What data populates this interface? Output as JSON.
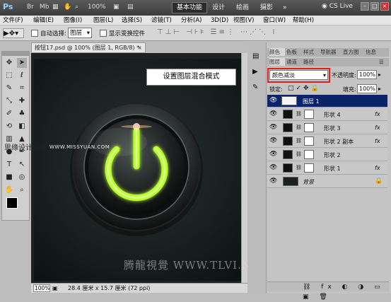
{
  "app": {
    "logo": "Ps"
  },
  "titlebar": {
    "zoom": "100%",
    "workspaces": [
      "基本功能",
      "设计",
      "绘画",
      "摄影"
    ],
    "more": "»",
    "cs_live": "CS Live",
    "min": "–",
    "max": "□",
    "close": "×"
  },
  "menu": [
    "文件(F)",
    "编辑(E)",
    "图像(I)",
    "图层(L)",
    "选择(S)",
    "滤镜(T)",
    "分析(A)",
    "3D(D)",
    "视图(V)",
    "窗口(W)",
    "帮助(H)"
  ],
  "options": {
    "auto_select_label": "自动选择:",
    "auto_select_value": "图层",
    "show_transform": "显示变换控件"
  },
  "document": {
    "tab_title": "按钮17.psd @ 100% (图层 1, RGB/8) *",
    "tab_close": "×",
    "zoom": "100%",
    "size_info": "28.4 厘米 x 15.7 厘米 (72 ppi)"
  },
  "annotation": {
    "callout": "设置图层混合模式"
  },
  "watermarks": {
    "left": "思缘设计论坛",
    "left_url": "WWW.MISSYUAN.COM",
    "bottom": "腾龍視覺 WWW.TLVI.NET"
  },
  "panels": {
    "top_tabs": [
      "颜色",
      "色板",
      "样式",
      "导航器",
      "直方图",
      "信息"
    ],
    "layer_tabs": [
      "图层",
      "通道",
      "路径"
    ],
    "blend_mode": "颜色减淡",
    "opacity_label": "不透明度:",
    "opacity_value": "100%",
    "lock_label": "锁定:",
    "fill_label": "填充:",
    "fill_value": "100%",
    "fx": "fx"
  },
  "layers": [
    {
      "name": "图层 1",
      "selected": true
    },
    {
      "name": "形状 4",
      "fx": true
    },
    {
      "name": "形状 3",
      "fx": true
    },
    {
      "name": "形状 2 副本",
      "fx": true
    },
    {
      "name": "形状 2",
      "fx": false
    },
    {
      "name": "形状 1",
      "fx": true
    },
    {
      "name": "背景",
      "locked": true
    }
  ],
  "colors": {
    "accent_select": "#0a246a",
    "highlight": "#e0201a",
    "glow": "#b8ff30"
  }
}
